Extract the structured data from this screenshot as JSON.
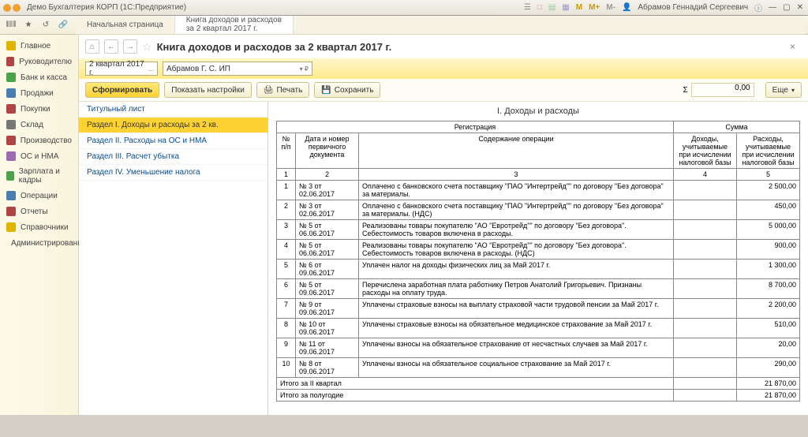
{
  "titlebar": {
    "title": "Демо Бухгалтерия КОРП (1С:Предприятие)",
    "user": "Абрамов Геннадий Сергеевич"
  },
  "tabs": {
    "home": "Начальная страница",
    "current_l1": "Книга доходов и расходов",
    "current_l2": "за 2 квартал 2017 г."
  },
  "sidebar": [
    {
      "label": "Главное",
      "color": "#e0b400"
    },
    {
      "label": "Руководителю",
      "color": "#b04545"
    },
    {
      "label": "Банк и касса",
      "color": "#4aa34a"
    },
    {
      "label": "Продажи",
      "color": "#4a7db0"
    },
    {
      "label": "Покупки",
      "color": "#b04545"
    },
    {
      "label": "Склад",
      "color": "#777777"
    },
    {
      "label": "Производство",
      "color": "#b04545"
    },
    {
      "label": "ОС и НМА",
      "color": "#9e6ab0"
    },
    {
      "label": "Зарплата и кадры",
      "color": "#4aa34a"
    },
    {
      "label": "Операции",
      "color": "#4a7db0"
    },
    {
      "label": "Отчеты",
      "color": "#b04545"
    },
    {
      "label": "Справочники",
      "color": "#e0b400"
    },
    {
      "label": "Администрирование",
      "color": "#555555"
    }
  ],
  "page": {
    "title": "Книга доходов и расходов за 2 квартал 2017 г."
  },
  "filter": {
    "period": "2 квартал 2017 г.",
    "org": "Абрамов Г. С. ИП"
  },
  "actions": {
    "form": "Сформировать",
    "show_settings": "Показать настройки",
    "print": "Печать",
    "save": "Сохранить",
    "still": "Еще",
    "sigma": "Σ",
    "sum": "0,00"
  },
  "section_list": [
    "Титульный лист",
    "Раздел I. Доходы и расходы за 2 кв.",
    "Раздел II. Расходы на ОС и НМА",
    "Раздел III. Расчет убытка",
    "Раздел IV. Уменьшение налога"
  ],
  "report": {
    "section_title": "I. Доходы и расходы",
    "head": {
      "reg": "Регистрация",
      "sum": "Сумма",
      "num": "№ п/п",
      "date_doc": "Дата и номер первичного документа",
      "content": "Содержание операции",
      "income": "Доходы, учитываемые при исчислении налоговой базы",
      "expense": "Расходы, учитываемые при исчислении налоговой базы",
      "c1": "1",
      "c2": "2",
      "c3": "3",
      "c4": "4",
      "c5": "5"
    },
    "rows": [
      {
        "n": "1",
        "doc": "№ 3 от 02.06.2017",
        "text": "Оплачено с банковского счета поставщику \"ПАО \"Интертрейд\"\" по договору \"Без договора\" за материалы.",
        "inc": "",
        "exp": "2 500,00"
      },
      {
        "n": "2",
        "doc": "№ 3 от 02.06.2017",
        "text": "Оплачено с банковского счета поставщику \"ПАО \"Интертрейд\"\" по договору \"Без договора\" за материалы. (НДС)",
        "inc": "",
        "exp": "450,00"
      },
      {
        "n": "3",
        "doc": "№ 5 от 06.06.2017",
        "text": "Реализованы товары покупателю \"АО \"Евротрейд\"\" по договору \"Без договора\". Себестоимость товаров включена в расходы.",
        "inc": "",
        "exp": "5 000,00"
      },
      {
        "n": "4",
        "doc": "№ 5 от 06.06.2017",
        "text": "Реализованы товары покупателю \"АО \"Евротрейд\"\" по договору \"Без договора\". Себестоимость товаров включена в расходы. (НДС)",
        "inc": "",
        "exp": "900,00"
      },
      {
        "n": "5",
        "doc": "№ 6 от 09.06.2017",
        "text": "Уплачен налог на доходы физических лиц за Май 2017 г.",
        "inc": "",
        "exp": "1 300,00"
      },
      {
        "n": "6",
        "doc": "№ 5 от 09.06.2017",
        "text": "Перечислена заработная плата работнику Петров Анатолий Григорьевич. Признаны расходы на оплату труда.",
        "inc": "",
        "exp": "8 700,00"
      },
      {
        "n": "7",
        "doc": "№ 9 от 09.06.2017",
        "text": "Уплачены страховые взносы на выплату страховой части трудовой пенсии за Май 2017 г.",
        "inc": "",
        "exp": "2 200,00"
      },
      {
        "n": "8",
        "doc": "№ 10 от 09.06.2017",
        "text": "Уплачены страховые взносы на обязательное медицинское страхование за Май 2017 г.",
        "inc": "",
        "exp": "510,00"
      },
      {
        "n": "9",
        "doc": "№ 11 от 09.06.2017",
        "text": "Уплачены взносы на обязательное страхование от несчастных случаев за Май 2017 г.",
        "inc": "",
        "exp": "20,00"
      },
      {
        "n": "10",
        "doc": "№ 8 от 09.06.2017",
        "text": "Уплачены взносы на обязательное социальное страхование за Май 2017 г.",
        "inc": "",
        "exp": "290,00"
      }
    ],
    "totals": [
      {
        "label": "Итого за II квартал",
        "inc": "",
        "exp": "21 870,00"
      },
      {
        "label": "Итого за полугодие",
        "inc": "",
        "exp": "21 870,00"
      }
    ]
  }
}
